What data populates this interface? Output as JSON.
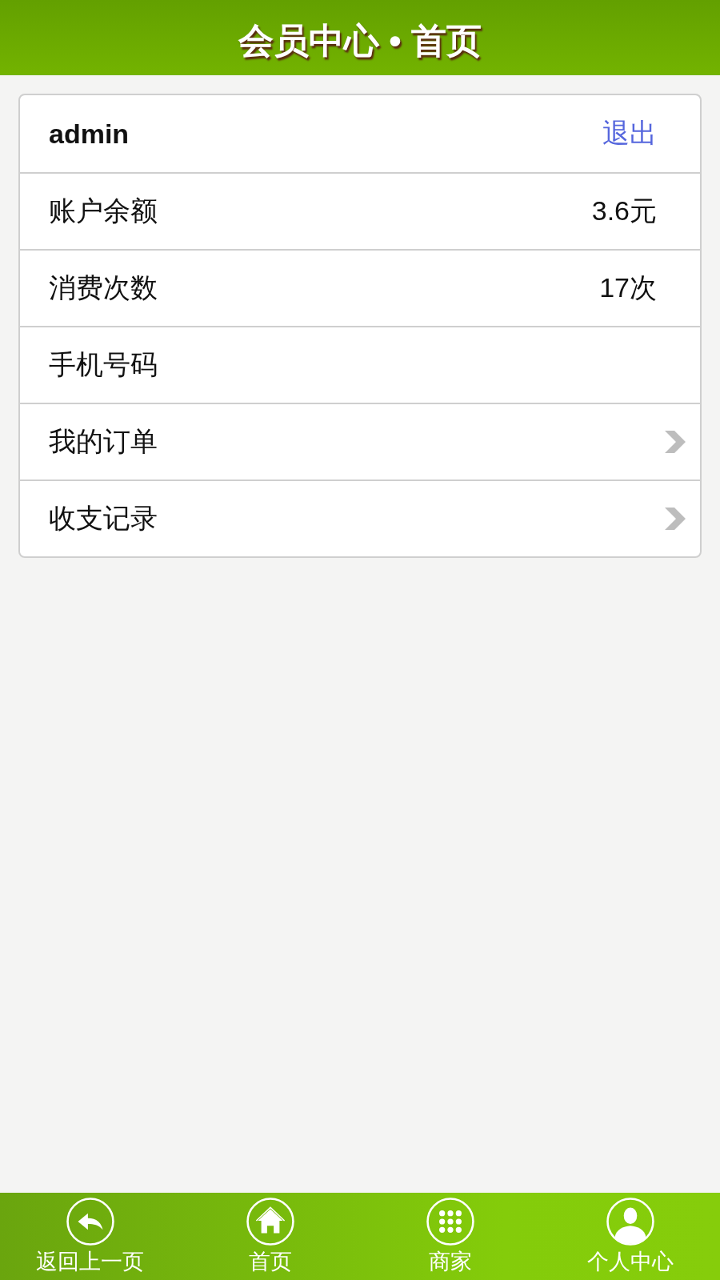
{
  "header": {
    "title": "会员中心 • 首页"
  },
  "rows": [
    {
      "kind": "user",
      "label": "admin",
      "action": "退出"
    },
    {
      "kind": "value",
      "label": "账户余额",
      "value": "3.6元"
    },
    {
      "kind": "value",
      "label": "消费次数",
      "value": "17次"
    },
    {
      "kind": "value",
      "label": "手机号码"
    },
    {
      "kind": "nav",
      "label": "我的订单"
    },
    {
      "kind": "nav",
      "label": "收支记录"
    }
  ],
  "bottom_nav": [
    {
      "label": "返回上一页"
    },
    {
      "label": "首页"
    },
    {
      "label": "商家"
    },
    {
      "label": "个人中心"
    }
  ]
}
